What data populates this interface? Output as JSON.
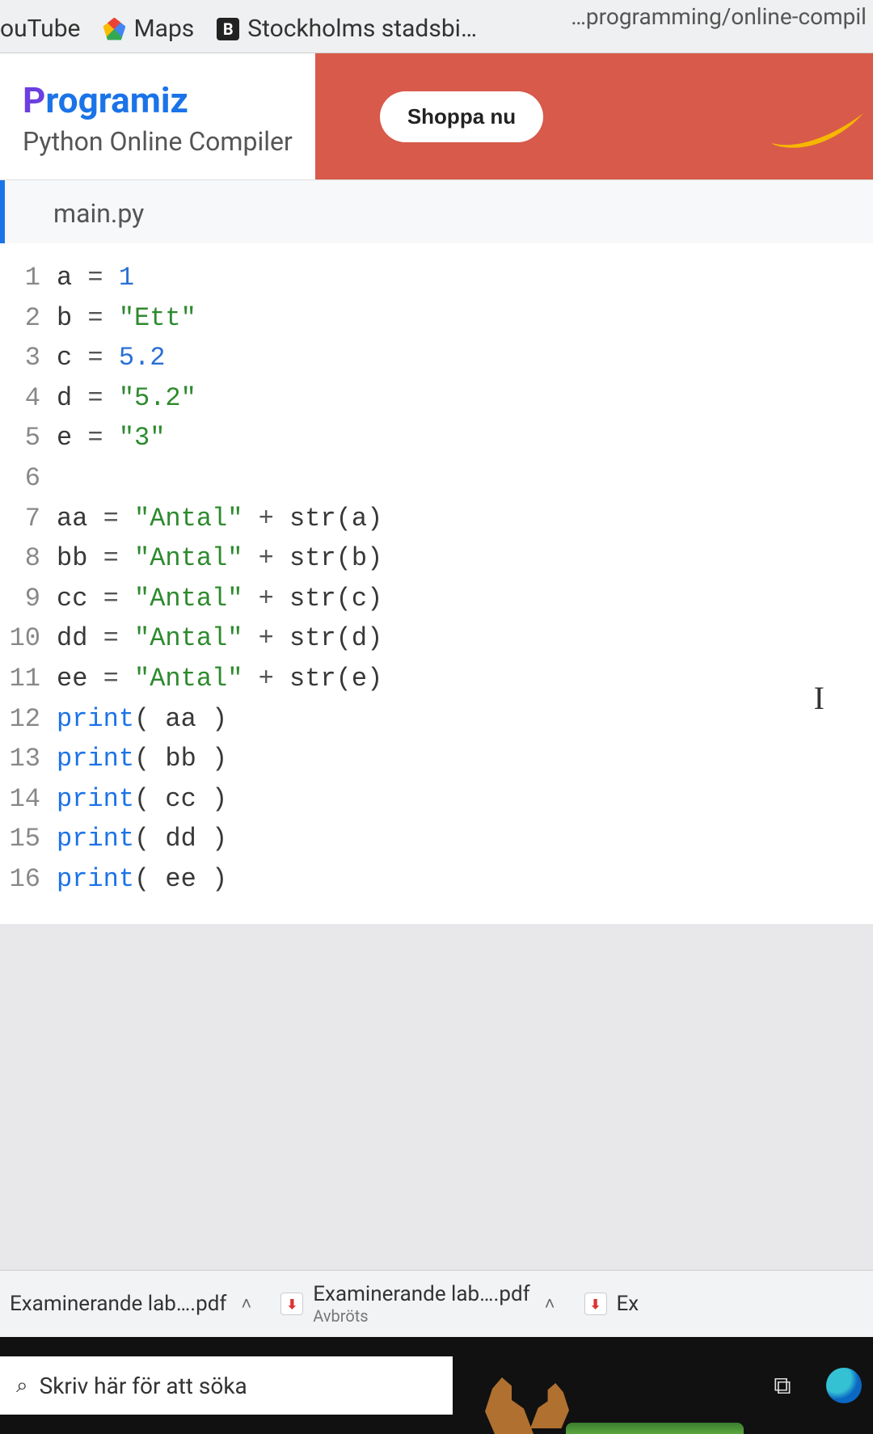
{
  "url_fragment": "…programming/online-compil",
  "bookmarks": {
    "youtube": "ouTube",
    "maps": "Maps",
    "stockholm": "Stockholms stadsbi…"
  },
  "brand": {
    "p": "P",
    "rest": "rogramiz"
  },
  "subtitle": "Python Online Compiler",
  "ad": {
    "button": "Shoppa nu"
  },
  "file_tab": "main.py",
  "code": {
    "lines": [
      {
        "n": "1",
        "html": "a <span class='tok-op'>=</span> <span class='tok-num'>1</span>"
      },
      {
        "n": "2",
        "html": "b <span class='tok-op'>=</span> <span class='tok-str'>\"Ett\"</span>"
      },
      {
        "n": "3",
        "html": "c <span class='tok-op'>=</span> <span class='tok-num'>5.2</span>"
      },
      {
        "n": "4",
        "html": "d <span class='tok-op'>=</span> <span class='tok-str'>\"5.2\"</span>"
      },
      {
        "n": "5",
        "html": "e <span class='tok-op'>=</span> <span class='tok-str'>\"3\"</span>"
      },
      {
        "n": "6",
        "html": ""
      },
      {
        "n": "7",
        "html": "aa <span class='tok-op'>=</span> <span class='tok-str'>\"Antal\"</span> <span class='tok-op'>+</span> str(a)"
      },
      {
        "n": "8",
        "html": "bb <span class='tok-op'>=</span> <span class='tok-str'>\"Antal\"</span> <span class='tok-op'>+</span> str(b)"
      },
      {
        "n": "9",
        "html": "cc <span class='tok-op'>=</span> <span class='tok-str'>\"Antal\"</span> <span class='tok-op'>+</span> str(c)"
      },
      {
        "n": "10",
        "html": "dd <span class='tok-op'>=</span> <span class='tok-str'>\"Antal\"</span> <span class='tok-op'>+</span> str(d)"
      },
      {
        "n": "11",
        "html": "ee <span class='tok-op'>=</span> <span class='tok-str'>\"Antal\"</span> <span class='tok-op'>+</span> str(e)"
      },
      {
        "n": "12",
        "html": "<span class='tok-kw'>print</span>( aa )"
      },
      {
        "n": "13",
        "html": "<span class='tok-kw'>print</span>( bb )"
      },
      {
        "n": "14",
        "html": "<span class='tok-kw'>print</span>( cc )"
      },
      {
        "n": "15",
        "html": "<span class='tok-kw'>print</span>( dd )"
      },
      {
        "n": "16",
        "html": "<span class='tok-kw'>print</span>( ee )"
      }
    ]
  },
  "downloads": {
    "item1": {
      "name": "Examinerande lab….pdf"
    },
    "item2": {
      "name": "Examinerande lab….pdf",
      "status": "Avbröts"
    },
    "item3": {
      "name": "Ex"
    }
  },
  "taskbar": {
    "search_placeholder": "Skriv här för att söka"
  },
  "glyphs": {
    "b": "B",
    "search": "⌕",
    "caret": "I",
    "chev_up": "˄",
    "taskview": "⧉",
    "pdf": "📄"
  }
}
